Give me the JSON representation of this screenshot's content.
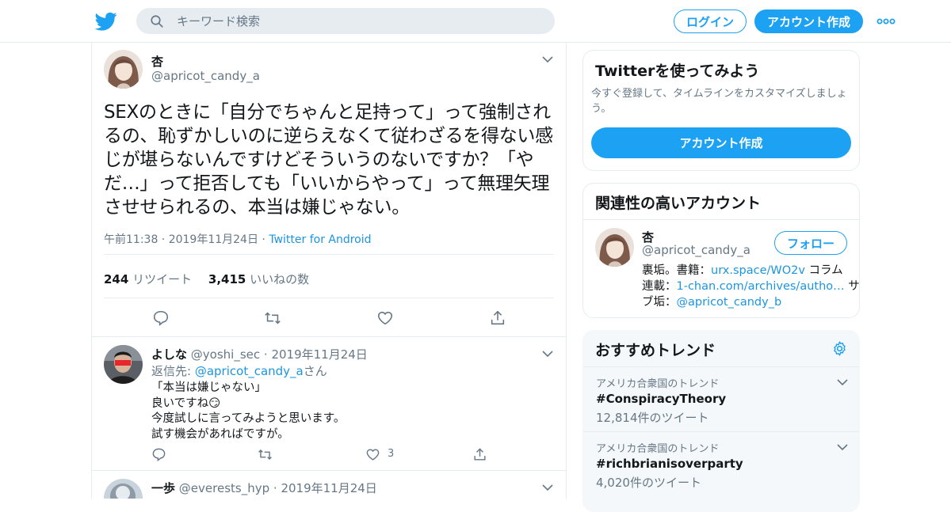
{
  "search": {
    "placeholder": "キーワード検索"
  },
  "header": {
    "login_label": "ログイン",
    "signup_label": "アカウント作成"
  },
  "tweet": {
    "name": "杏",
    "handle": "@apricot_candy_a",
    "text": "SEXのときに「自分でちゃんと足持って」って強制されるの、恥ずかしいのに逆らえなくて従わざるを得ない感じが堪らないんですけどそういうのないですか？「やだ…」って拒否しても「いいからやって」って無理矢理させせられるの、本当は嫌じゃない。",
    "time": "午前11:38 · 2019年11月24日",
    "sep": "·",
    "client": "Twitter for Android",
    "retweets": "244",
    "retweets_label": "リツイート",
    "likes": "3,415",
    "likes_label": "いいねの数"
  },
  "replies": [
    {
      "name": "よしな",
      "handle": "@yoshi_sec",
      "date": "· 2019年11月24日",
      "reply_prefix": "返信先:",
      "reply_to": "@apricot_candy_a",
      "reply_suffix": "さん",
      "lines": [
        "「本当は嫌じゃない」",
        "良いですね😏",
        "今度試しに言ってみようと思います。",
        "試す機会があればですが。"
      ],
      "like_count": "3"
    },
    {
      "name": "一歩",
      "handle": "@everests_hyp",
      "date": "· 2019年11月24日"
    }
  ],
  "signup_card": {
    "title": "Twitterを使ってみよう",
    "desc": "今すぐ登録して、タイムラインをカスタマイズしましょう。",
    "button": "アカウント作成"
  },
  "related": {
    "title": "関連性の高いアカウント",
    "name": "杏",
    "handle": "@apricot_candy_a",
    "follow": "フォロー",
    "bio_1a": "裏垢。書籍：",
    "bio_1link": "urx.space/WO2v",
    "bio_1b": " コラム",
    "bio_2a": "連載：",
    "bio_2link": "1-chan.com/archives/autho…",
    "bio_2b": " サ",
    "bio_3a": "ブ垢：",
    "bio_3link": "@apricot_candy_b"
  },
  "trends": {
    "title": "おすすめトレンド",
    "items": [
      {
        "category": "アメリカ合衆国のトレンド",
        "name": "#ConspiracyTheory",
        "count": "12,814件のツイート"
      },
      {
        "category": "アメリカ合衆国のトレンド",
        "name": "#richbrianisoverparty",
        "count": "4,020件のツイート"
      }
    ]
  },
  "colors": {
    "accent": "#1da1f2",
    "link": "#1b95e0",
    "muted": "#657786",
    "border": "#e6ecf0"
  },
  "icons": [
    "twitter-bird-icon",
    "search-icon",
    "more-dots-icon",
    "chevron-down-icon",
    "reply-icon",
    "retweet-icon",
    "like-icon",
    "share-icon",
    "settings-gear-icon"
  ]
}
